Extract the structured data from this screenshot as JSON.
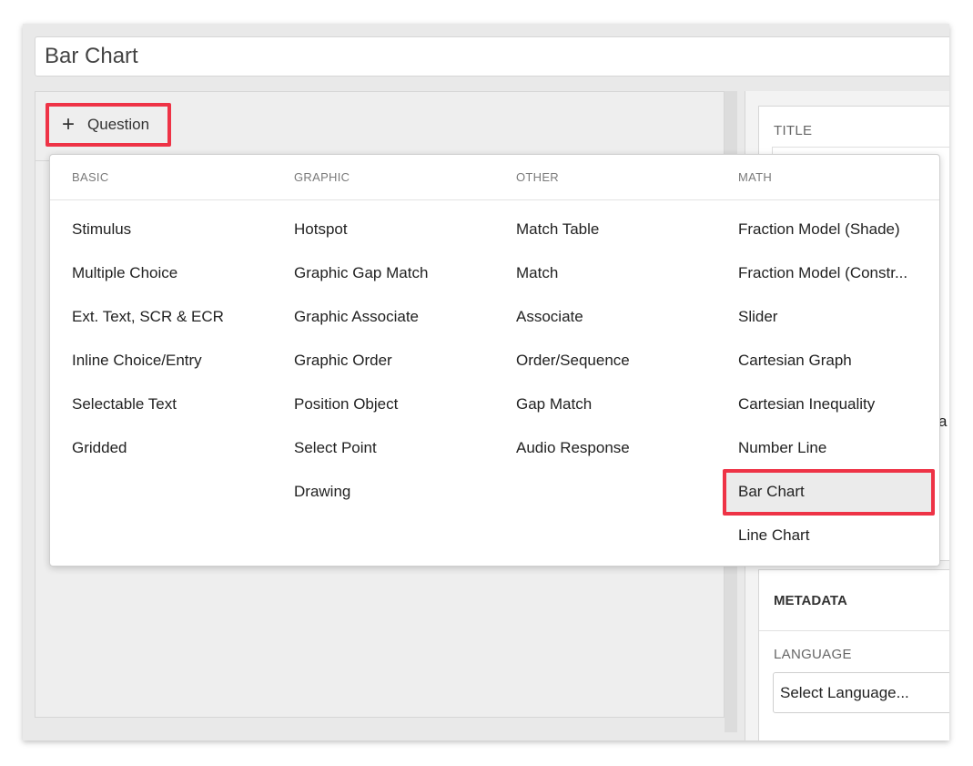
{
  "title_input": {
    "value": "Bar Chart"
  },
  "add_question": {
    "plus_icon": "+",
    "label": "Question"
  },
  "highlight_color": "#ee3346",
  "dropdown": {
    "columns": [
      {
        "heading": "BASIC",
        "items": [
          "Stimulus",
          "Multiple Choice",
          "Ext. Text, SCR & ECR",
          "Inline Choice/Entry",
          "Selectable Text",
          "Gridded"
        ]
      },
      {
        "heading": "GRAPHIC",
        "items": [
          "Hotspot",
          "Graphic Gap Match",
          "Graphic Associate",
          "Graphic Order",
          "Position Object",
          "Select Point",
          "Drawing"
        ]
      },
      {
        "heading": "OTHER",
        "items": [
          "Match Table",
          "Match",
          "Associate",
          "Order/Sequence",
          "Gap Match",
          "Audio Response"
        ]
      },
      {
        "heading": "MATH",
        "items": [
          "Fraction Model (Shade)",
          "Fraction Model (Constr...",
          "Slider",
          "Cartesian Graph",
          "Cartesian Inequality",
          "Number Line",
          "Bar Chart",
          "Line Chart"
        ]
      }
    ],
    "selected_item": "Bar Chart"
  },
  "right_panel": {
    "title_label": "TITLE",
    "metadata_heading": "METADATA",
    "language_label": "LANGUAGE",
    "language_select": "Select Language...",
    "cut_text": "a"
  }
}
